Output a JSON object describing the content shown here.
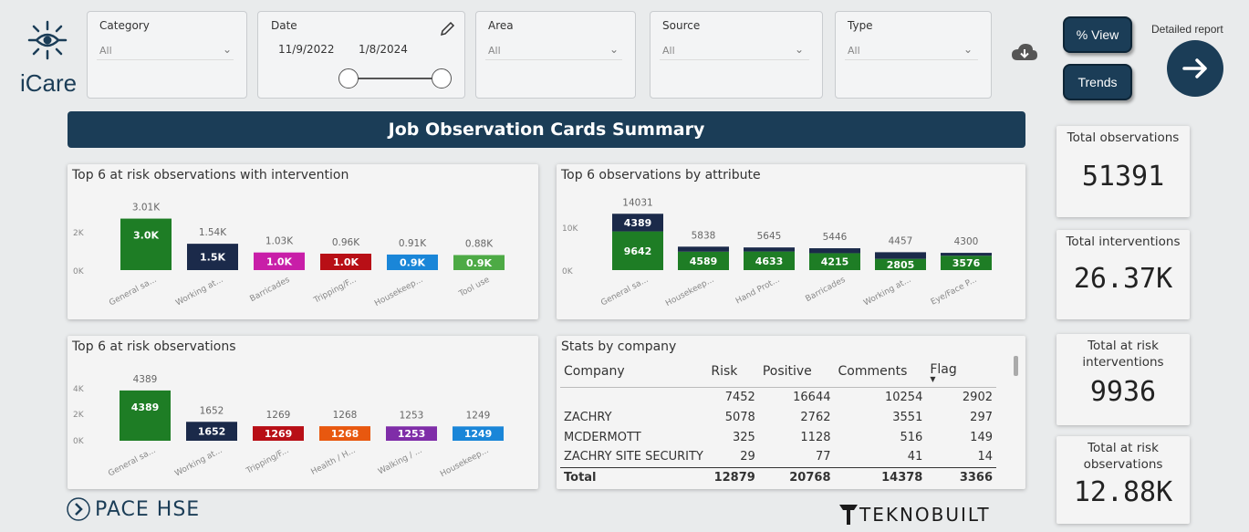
{
  "app": {
    "name": "iCare"
  },
  "filters": [
    {
      "label": "Category",
      "value": "All"
    },
    {
      "label": "Area",
      "value": "All"
    },
    {
      "label": "Source",
      "value": "All"
    },
    {
      "label": "Type",
      "value": "All"
    }
  ],
  "date": {
    "label": "Date",
    "start": "11/9/2022",
    "end": "1/8/2024"
  },
  "buttons": {
    "pct_view": "% View",
    "trends": "Trends",
    "detailed_report": "Detailed report"
  },
  "banner": {
    "title": "Job Observation Cards Summary"
  },
  "colors": {
    "navy": "#1b3d57",
    "green": "#1e7d25",
    "darkblue": "#1b2a4a"
  },
  "chart_data": [
    {
      "type": "bar",
      "title": "Top 6 at risk observations with intervention",
      "categories": [
        "General sa...",
        "Working at...",
        "Barricades",
        "Tripping/F...",
        "Housekeep...",
        "Tool use"
      ],
      "values": [
        3010,
        1540,
        1030,
        960,
        910,
        880
      ],
      "total_labels": [
        "3.01K",
        "1.54K",
        "1.03K",
        "0.96K",
        "0.91K",
        "0.88K"
      ],
      "bar_labels": [
        "3.0K",
        "1.5K",
        "1.0K",
        "1.0K",
        "0.9K",
        "0.9K"
      ],
      "bar_colors": [
        "#1e7d25",
        "#1b2a4a",
        "#c81ea8",
        "#b80f16",
        "#1a86d8",
        "#4daa45"
      ],
      "yticks": [
        "2K",
        "0K"
      ],
      "ylim": [
        0,
        3200
      ]
    },
    {
      "type": "bar",
      "stacked": true,
      "title": "Top 6 observations by attribute",
      "categories": [
        "General sa...",
        "Housekeep...",
        "Hand Prot...",
        "Barricades",
        "Working at...",
        "Eye/Face P..."
      ],
      "series": [
        {
          "values": [
            9642,
            4589,
            4633,
            4215,
            2805,
            3576
          ],
          "color": "#1e7d25"
        },
        {
          "values": [
            4389,
            1249,
            1012,
            1231,
            1652,
            724
          ],
          "color": "#1b2a4a"
        }
      ],
      "totals": [
        14031,
        5838,
        5645,
        5446,
        4457,
        4300
      ],
      "total_labels": [
        "14031",
        "5838",
        "5645",
        "5446",
        "4457",
        "4300"
      ],
      "bottom_labels": [
        "9642",
        "4589",
        "4633",
        "4215",
        "2805",
        "3576"
      ],
      "top_labels": [
        "4389",
        "",
        "",
        "",
        "",
        ""
      ],
      "yticks": [
        "10K",
        "0K"
      ],
      "ylim": [
        0,
        15000
      ]
    },
    {
      "type": "bar",
      "title": "Top 6 at risk observations",
      "categories": [
        "General sa...",
        "Working at...",
        "Tripping/F...",
        "Health / H...",
        "Walking / ...",
        "Housekeep..."
      ],
      "values": [
        4389,
        1652,
        1269,
        1268,
        1253,
        1249
      ],
      "total_labels": [
        "4389",
        "1652",
        "1269",
        "1268",
        "1253",
        "1249"
      ],
      "bar_labels": [
        "4389",
        "1652",
        "1269",
        "1268",
        "1253",
        "1249"
      ],
      "bar_colors": [
        "#1e7d25",
        "#1b2a4a",
        "#b80f16",
        "#e8580f",
        "#7f2da8",
        "#1a86d8"
      ],
      "yticks": [
        "4K",
        "2K",
        "0K"
      ],
      "ylim": [
        0,
        4700
      ]
    }
  ],
  "stats": {
    "title": "Stats by company",
    "columns": [
      "Company",
      "Risk",
      "Positive",
      "Comments",
      "Flag"
    ],
    "rows": [
      [
        "",
        "7452",
        "16644",
        "10254",
        "2902"
      ],
      [
        "ZACHRY",
        "5078",
        "2762",
        "3551",
        "297"
      ],
      [
        "MCDERMOTT",
        "325",
        "1128",
        "516",
        "149"
      ],
      [
        "ZACHRY SITE SECURITY",
        "29",
        "77",
        "41",
        "14"
      ]
    ],
    "total": [
      "Total",
      "12879",
      "20768",
      "14378",
      "3366"
    ]
  },
  "kpis": [
    {
      "title": "Total observations",
      "value": "51391"
    },
    {
      "title": "Total interventions",
      "value": "26.37K"
    },
    {
      "title": "Total at risk interventions",
      "value": "9936"
    },
    {
      "title": "Total at risk observations",
      "value": "12.88K"
    }
  ],
  "footer": {
    "left_brand": "PACE HSE",
    "right_brand": "TEKNOBUILT"
  }
}
